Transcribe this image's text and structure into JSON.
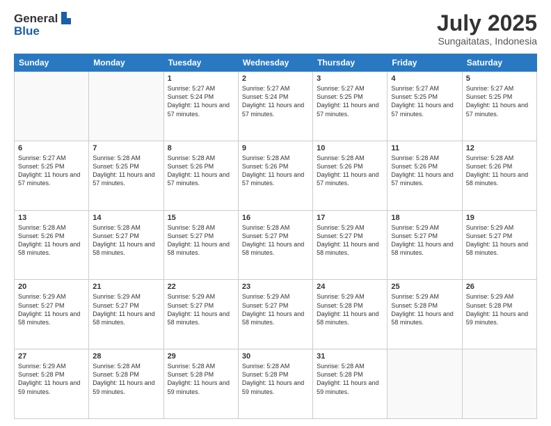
{
  "logo": {
    "general": "General",
    "blue": "Blue"
  },
  "header": {
    "month": "July 2025",
    "location": "Sungaitatas, Indonesia"
  },
  "weekdays": [
    "Sunday",
    "Monday",
    "Tuesday",
    "Wednesday",
    "Thursday",
    "Friday",
    "Saturday"
  ],
  "weeks": [
    [
      {
        "day": "",
        "info": ""
      },
      {
        "day": "",
        "info": ""
      },
      {
        "day": "1",
        "sunrise": "5:27 AM",
        "sunset": "5:24 PM",
        "daylight": "11 hours and 57 minutes."
      },
      {
        "day": "2",
        "sunrise": "5:27 AM",
        "sunset": "5:24 PM",
        "daylight": "11 hours and 57 minutes."
      },
      {
        "day": "3",
        "sunrise": "5:27 AM",
        "sunset": "5:25 PM",
        "daylight": "11 hours and 57 minutes."
      },
      {
        "day": "4",
        "sunrise": "5:27 AM",
        "sunset": "5:25 PM",
        "daylight": "11 hours and 57 minutes."
      },
      {
        "day": "5",
        "sunrise": "5:27 AM",
        "sunset": "5:25 PM",
        "daylight": "11 hours and 57 minutes."
      }
    ],
    [
      {
        "day": "6",
        "sunrise": "5:27 AM",
        "sunset": "5:25 PM",
        "daylight": "11 hours and 57 minutes."
      },
      {
        "day": "7",
        "sunrise": "5:28 AM",
        "sunset": "5:25 PM",
        "daylight": "11 hours and 57 minutes."
      },
      {
        "day": "8",
        "sunrise": "5:28 AM",
        "sunset": "5:26 PM",
        "daylight": "11 hours and 57 minutes."
      },
      {
        "day": "9",
        "sunrise": "5:28 AM",
        "sunset": "5:26 PM",
        "daylight": "11 hours and 57 minutes."
      },
      {
        "day": "10",
        "sunrise": "5:28 AM",
        "sunset": "5:26 PM",
        "daylight": "11 hours and 57 minutes."
      },
      {
        "day": "11",
        "sunrise": "5:28 AM",
        "sunset": "5:26 PM",
        "daylight": "11 hours and 57 minutes."
      },
      {
        "day": "12",
        "sunrise": "5:28 AM",
        "sunset": "5:26 PM",
        "daylight": "11 hours and 58 minutes."
      }
    ],
    [
      {
        "day": "13",
        "sunrise": "5:28 AM",
        "sunset": "5:26 PM",
        "daylight": "11 hours and 58 minutes."
      },
      {
        "day": "14",
        "sunrise": "5:28 AM",
        "sunset": "5:27 PM",
        "daylight": "11 hours and 58 minutes."
      },
      {
        "day": "15",
        "sunrise": "5:28 AM",
        "sunset": "5:27 PM",
        "daylight": "11 hours and 58 minutes."
      },
      {
        "day": "16",
        "sunrise": "5:28 AM",
        "sunset": "5:27 PM",
        "daylight": "11 hours and 58 minutes."
      },
      {
        "day": "17",
        "sunrise": "5:29 AM",
        "sunset": "5:27 PM",
        "daylight": "11 hours and 58 minutes."
      },
      {
        "day": "18",
        "sunrise": "5:29 AM",
        "sunset": "5:27 PM",
        "daylight": "11 hours and 58 minutes."
      },
      {
        "day": "19",
        "sunrise": "5:29 AM",
        "sunset": "5:27 PM",
        "daylight": "11 hours and 58 minutes."
      }
    ],
    [
      {
        "day": "20",
        "sunrise": "5:29 AM",
        "sunset": "5:27 PM",
        "daylight": "11 hours and 58 minutes."
      },
      {
        "day": "21",
        "sunrise": "5:29 AM",
        "sunset": "5:27 PM",
        "daylight": "11 hours and 58 minutes."
      },
      {
        "day": "22",
        "sunrise": "5:29 AM",
        "sunset": "5:27 PM",
        "daylight": "11 hours and 58 minutes."
      },
      {
        "day": "23",
        "sunrise": "5:29 AM",
        "sunset": "5:27 PM",
        "daylight": "11 hours and 58 minutes."
      },
      {
        "day": "24",
        "sunrise": "5:29 AM",
        "sunset": "5:28 PM",
        "daylight": "11 hours and 58 minutes."
      },
      {
        "day": "25",
        "sunrise": "5:29 AM",
        "sunset": "5:28 PM",
        "daylight": "11 hours and 58 minutes."
      },
      {
        "day": "26",
        "sunrise": "5:29 AM",
        "sunset": "5:28 PM",
        "daylight": "11 hours and 59 minutes."
      }
    ],
    [
      {
        "day": "27",
        "sunrise": "5:29 AM",
        "sunset": "5:28 PM",
        "daylight": "11 hours and 59 minutes."
      },
      {
        "day": "28",
        "sunrise": "5:28 AM",
        "sunset": "5:28 PM",
        "daylight": "11 hours and 59 minutes."
      },
      {
        "day": "29",
        "sunrise": "5:28 AM",
        "sunset": "5:28 PM",
        "daylight": "11 hours and 59 minutes."
      },
      {
        "day": "30",
        "sunrise": "5:28 AM",
        "sunset": "5:28 PM",
        "daylight": "11 hours and 59 minutes."
      },
      {
        "day": "31",
        "sunrise": "5:28 AM",
        "sunset": "5:28 PM",
        "daylight": "11 hours and 59 minutes."
      },
      {
        "day": "",
        "info": ""
      },
      {
        "day": "",
        "info": ""
      }
    ]
  ]
}
